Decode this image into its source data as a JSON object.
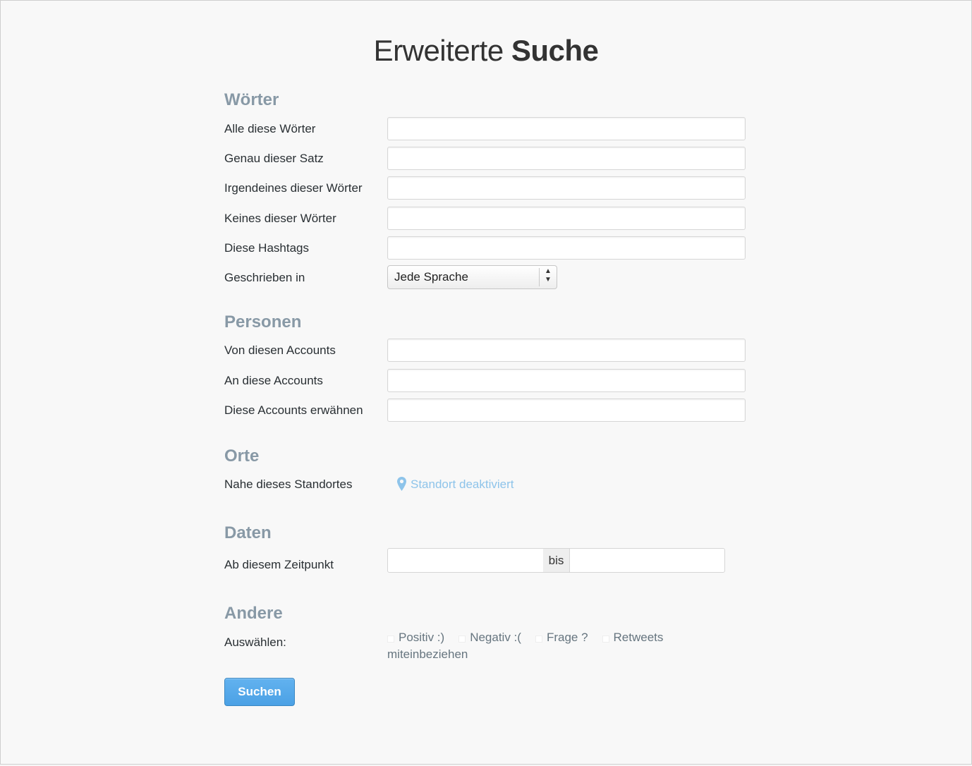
{
  "header": {
    "title_light": "Erweiterte",
    "title_bold": "Suche"
  },
  "words": {
    "heading": "Wörter",
    "all_words_label": "Alle diese Wörter",
    "exact_phrase_label": "Genau dieser Satz",
    "any_words_label": "Irgendeines dieser Wörter",
    "none_words_label": "Keines dieser Wörter",
    "hashtags_label": "Diese Hashtags",
    "language_label": "Geschrieben in",
    "language_value": "Jede Sprache",
    "all_words_value": "",
    "exact_phrase_value": "",
    "any_words_value": "",
    "none_words_value": "",
    "hashtags_value": ""
  },
  "people": {
    "heading": "Personen",
    "from_label": "Von diesen Accounts",
    "to_label": "An diese Accounts",
    "mention_label": "Diese Accounts erwähnen",
    "from_value": "",
    "to_value": "",
    "mention_value": ""
  },
  "places": {
    "heading": "Orte",
    "near_label": "Nahe dieses Standortes",
    "location_status": "Standort deaktiviert"
  },
  "dates": {
    "heading": "Daten",
    "since_label": "Ab diesem Zeitpunkt",
    "separator": "bis",
    "since_value": "",
    "until_value": ""
  },
  "other": {
    "heading": "Andere",
    "select_label": "Auswählen:",
    "options": [
      {
        "label": "Positiv :)",
        "checked": false
      },
      {
        "label": "Negativ :(",
        "checked": false
      },
      {
        "label": "Frage ?",
        "checked": false
      },
      {
        "label": "Retweets",
        "checked": false
      }
    ],
    "options_wrap": "miteinbeziehen"
  },
  "submit": {
    "label": "Suchen"
  },
  "colors": {
    "heading": "#8899a6",
    "accent": "#4ba1e5",
    "location": "#8ec4ea"
  },
  "icons": {
    "location": "map-pin-icon",
    "select": "updown-arrows-icon"
  }
}
